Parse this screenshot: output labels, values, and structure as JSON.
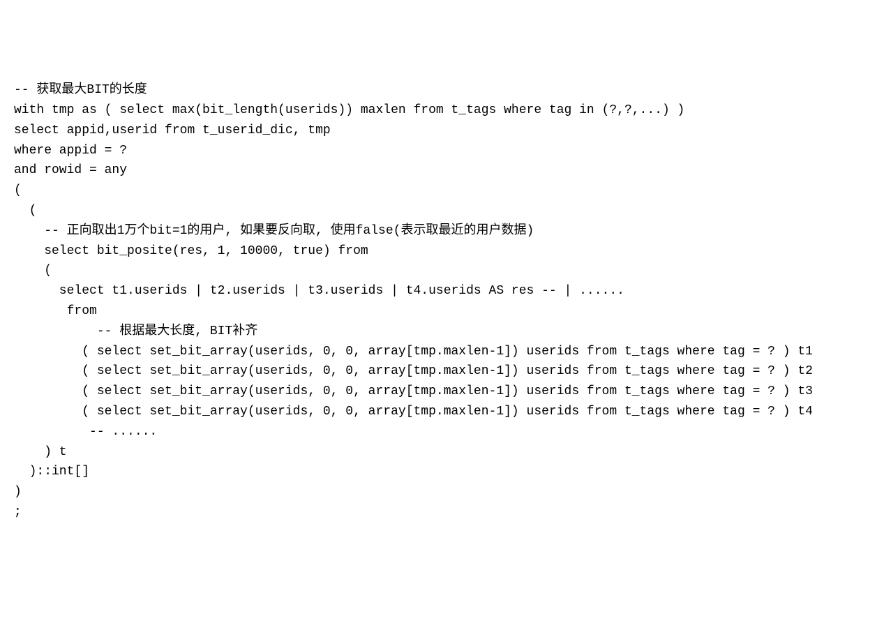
{
  "code": {
    "line1": "-- 获取最大BIT的长度",
    "line2": "with tmp as ( select max(bit_length(userids)) maxlen from t_tags where tag in (?,?,...) )",
    "line3": "select appid,userid from t_userid_dic, tmp",
    "line4": "where appid = ?",
    "line5": "and rowid = any ",
    "line6": "(",
    "line7": "  (",
    "line8": "    -- 正向取出1万个bit=1的用户, 如果要反向取, 使用false(表示取最近的用户数据)",
    "line9": "    select bit_posite(res, 1, 10000, true) from",
    "line10": "    (",
    "line11": "      select t1.userids | t2.userids | t3.userids | t4.userids AS res -- | ......",
    "line12": "       from",
    "line13": "           -- 根据最大长度, BIT补齐",
    "line14": "         ( select set_bit_array(userids, 0, 0, array[tmp.maxlen-1]) userids from t_tags where tag = ? ) t1 ",
    "line15": "         ( select set_bit_array(userids, 0, 0, array[tmp.maxlen-1]) userids from t_tags where tag = ? ) t2 ",
    "line16": "         ( select set_bit_array(userids, 0, 0, array[tmp.maxlen-1]) userids from t_tags where tag = ? ) t3 ",
    "line17": "         ( select set_bit_array(userids, 0, 0, array[tmp.maxlen-1]) userids from t_tags where tag = ? ) t4 ",
    "line18": "          -- ......",
    "line19": "    ) t",
    "line20": "  )::int[]",
    "line21": ")",
    "line22": ";"
  }
}
